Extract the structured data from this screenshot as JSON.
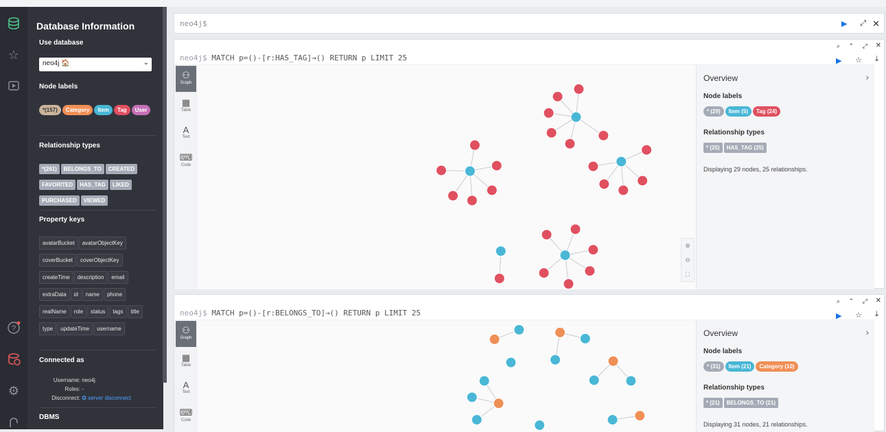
{
  "drawer": {
    "title": "Database Information",
    "use_database_label": "Use database",
    "database_selected": "neo4j 🏠",
    "node_labels_heading": "Node labels",
    "node_labels": [
      {
        "text": "*(157)",
        "color": "#c9b49b",
        "fg": "#333"
      },
      {
        "text": "Category",
        "color": "#f08f56",
        "fg": "#fff"
      },
      {
        "text": "Item",
        "color": "#49b7d6",
        "fg": "#fff"
      },
      {
        "text": "Tag",
        "color": "#e05060",
        "fg": "#fff"
      },
      {
        "text": "User",
        "color": "#c570b8",
        "fg": "#fff"
      }
    ],
    "relationship_types_heading": "Relationship types",
    "relationship_types": [
      "*(261)",
      "BELONGS_TO",
      "CREATED",
      "FAVORITED",
      "HAS_TAG",
      "LIKED",
      "PURCHASED",
      "VIEWED"
    ],
    "property_keys_heading": "Property keys",
    "property_keys": [
      "avatarBucket",
      "avatarObjectKey",
      "coverBucket",
      "coverObjectKey",
      "createTime",
      "description",
      "email",
      "extraData",
      "id",
      "name",
      "phone",
      "realName",
      "role",
      "status",
      "tags",
      "title",
      "type",
      "updateTime",
      "username"
    ],
    "connected_as_heading": "Connected as",
    "username_label": "Username:",
    "username_value": "neo4j",
    "roles_label": "Roles:",
    "roles_value": "-",
    "disconnect_label": "Disconnect:",
    "disconnect_link": "server disconnect",
    "dbms_heading": "DBMS"
  },
  "editor": {
    "prompt": "neo4j$"
  },
  "frames": [
    {
      "prompt": "neo4j$",
      "query": "MATCH p=()-[r:HAS_TAG]→() RETURN p LIMIT 25",
      "overview_title": "Overview",
      "node_labels_heading": "Node labels",
      "node_labels": [
        {
          "text": "* (29)",
          "color": "#a5abb6"
        },
        {
          "text": "Item (5)",
          "color": "#49b7d6"
        },
        {
          "text": "Tag (24)",
          "color": "#e05060"
        }
      ],
      "relationship_types_heading": "Relationship types",
      "relationship_types": [
        "* (25)",
        "HAS_TAG (25)"
      ],
      "summary": "Displaying 29 nodes, 25 relationships."
    },
    {
      "prompt": "neo4j$",
      "query": "MATCH p=()-[r:BELONGS_TO]→() RETURN p LIMIT 25",
      "overview_title": "Overview",
      "node_labels_heading": "Node labels",
      "node_labels": [
        {
          "text": "* (31)",
          "color": "#a5abb6"
        },
        {
          "text": "Item (21)",
          "color": "#49b7d6"
        },
        {
          "text": "Category (10)",
          "color": "#f08f56"
        }
      ],
      "relationship_types_heading": "Relationship types",
      "relationship_types": [
        "* (21)",
        "BELONGS_TO (21)"
      ],
      "summary": "Displaying 31 nodes, 21 relationships."
    }
  ],
  "view_tabs": [
    "Graph",
    "Table",
    "Text",
    "Code"
  ],
  "colors": {
    "item": "#49b7d6",
    "tag": "#e05060",
    "category": "#f08f56",
    "accent": "#1a73e8"
  }
}
